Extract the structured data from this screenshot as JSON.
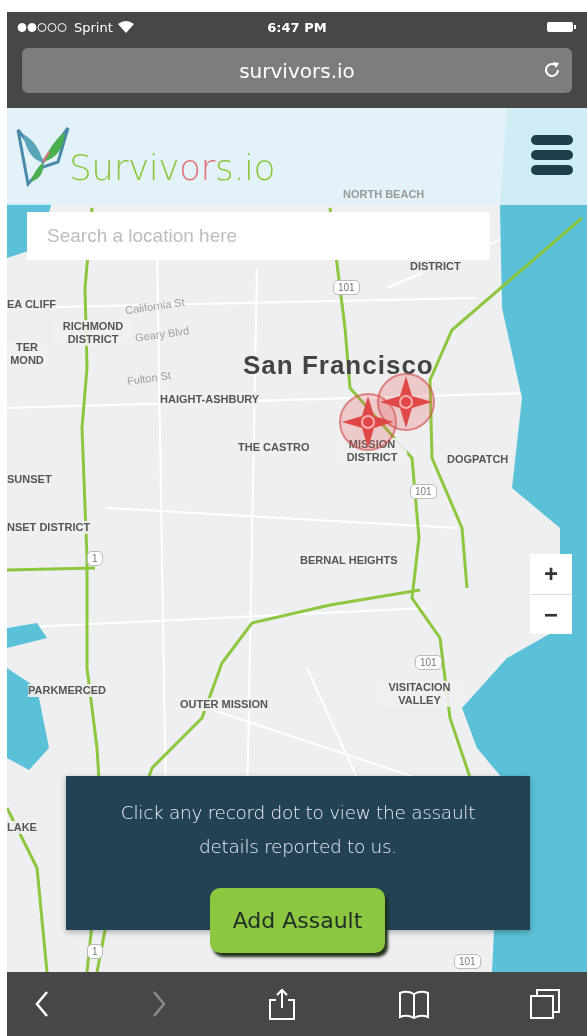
{
  "status_bar": {
    "carrier": "Sprint",
    "time": "6:47 PM"
  },
  "address_bar": {
    "url": "survivors.io"
  },
  "header": {
    "logo_parts": [
      {
        "text": "Surviv",
        "color": "#8dc63f"
      },
      {
        "text": "or",
        "color": "#e2707a"
      },
      {
        "text": "s.io",
        "color": "#8dc63f"
      }
    ]
  },
  "search": {
    "placeholder": "Search a location here"
  },
  "map_labels": [
    {
      "text": "NORTH BEACH",
      "kind": "faint"
    },
    {
      "text": "DISTRICT",
      "kind": "place"
    },
    {
      "text": "EA CLIFF",
      "kind": "place"
    },
    {
      "text": "RICHMOND DISTRICT",
      "kind": "place"
    },
    {
      "text": "TER MOND",
      "kind": "place"
    },
    {
      "text": "California St",
      "kind": "street"
    },
    {
      "text": "Geary Blvd",
      "kind": "street"
    },
    {
      "text": "Fulton St",
      "kind": "street"
    },
    {
      "text": "San Francisco",
      "kind": "city"
    },
    {
      "text": "HAIGHT-ASHBURY",
      "kind": "place"
    },
    {
      "text": "THE CASTRO",
      "kind": "place"
    },
    {
      "text": "MISSION DISTRICT",
      "kind": "place"
    },
    {
      "text": "DOGPATCH",
      "kind": "place"
    },
    {
      "text": "SUNSET",
      "kind": "place"
    },
    {
      "text": "NSET DISTRICT",
      "kind": "place"
    },
    {
      "text": "BERNAL HEIGHTS",
      "kind": "place"
    },
    {
      "text": "PARKMERCED",
      "kind": "place"
    },
    {
      "text": "OUTER MISSION",
      "kind": "place"
    },
    {
      "text": "VISITACION VALLEY",
      "kind": "place"
    },
    {
      "text": "LAKE",
      "kind": "place"
    }
  ],
  "highway_shields": [
    {
      "text": "101"
    },
    {
      "text": "101"
    },
    {
      "text": "101"
    },
    {
      "text": "101"
    },
    {
      "text": "1"
    },
    {
      "text": "1"
    }
  ],
  "zoom_controls": [
    "+",
    "−"
  ],
  "info_panel": {
    "message": "Click any record dot to view the assault details reported to us.",
    "button": "Add Assault"
  },
  "toolbar": [
    {
      "kind": "back",
      "disabled": false
    },
    {
      "kind": "forward",
      "disabled": true
    },
    {
      "kind": "share",
      "disabled": false
    },
    {
      "kind": "bookmarks",
      "disabled": false
    },
    {
      "kind": "tabs",
      "disabled": false
    }
  ]
}
